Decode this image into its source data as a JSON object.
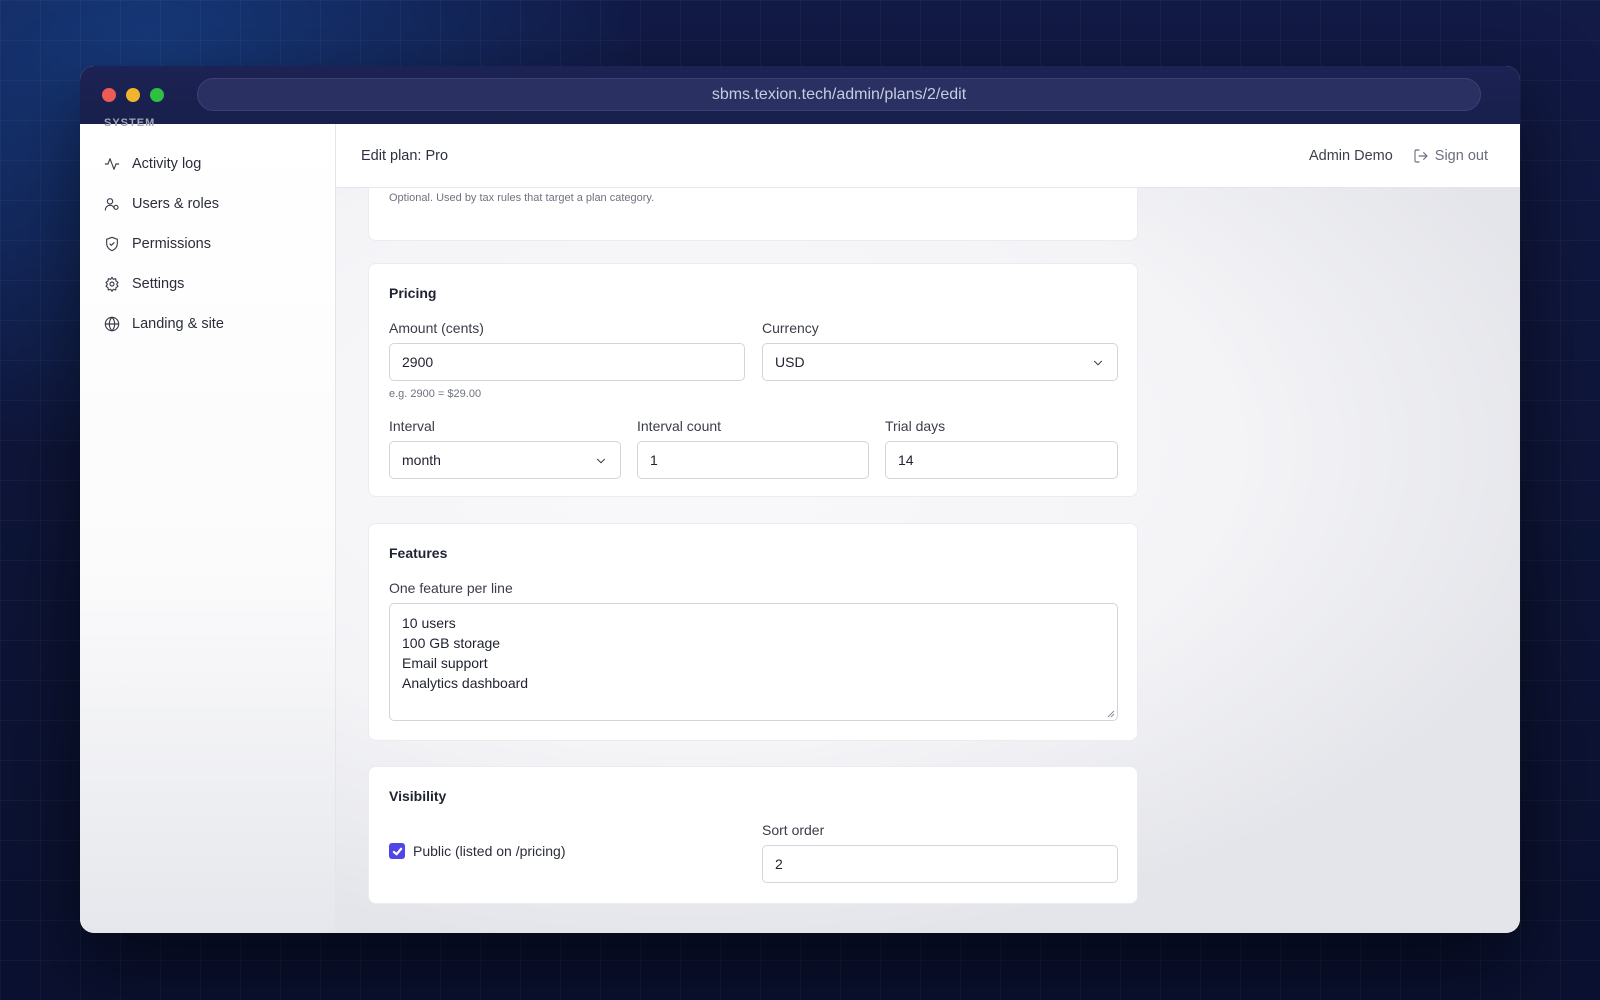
{
  "browser": {
    "url": "sbms.texion.tech/admin/plans/2/edit"
  },
  "sidebar": {
    "section_label": "System",
    "items": [
      {
        "label": "Activity log",
        "icon": "activity-icon"
      },
      {
        "label": "Users & roles",
        "icon": "users-icon"
      },
      {
        "label": "Permissions",
        "icon": "shield-icon"
      },
      {
        "label": "Settings",
        "icon": "gear-icon"
      },
      {
        "label": "Landing & site",
        "icon": "globe-icon"
      }
    ]
  },
  "header": {
    "title": "Edit plan: Pro",
    "user": "Admin Demo",
    "sign_out": "Sign out"
  },
  "category_card": {
    "hint": "Optional. Used by tax rules that target a plan category."
  },
  "pricing": {
    "title": "Pricing",
    "amount_label": "Amount (cents)",
    "amount_value": "2900",
    "amount_hint": "e.g. 2900 = $29.00",
    "currency_label": "Currency",
    "currency_value": "USD",
    "interval_label": "Interval",
    "interval_value": "month",
    "interval_count_label": "Interval count",
    "interval_count_value": "1",
    "trial_days_label": "Trial days",
    "trial_days_value": "14"
  },
  "features": {
    "title": "Features",
    "label": "One feature per line",
    "lines": [
      "10 users",
      "100 GB storage",
      "Email support",
      "Analytics dashboard"
    ]
  },
  "visibility": {
    "title": "Visibility",
    "public_label": "Public (listed on /pricing)",
    "public_checked": true,
    "sort_label": "Sort order",
    "sort_value": "2"
  },
  "colors": {
    "accent": "#4f46e5",
    "titlebar": "#1c2354"
  }
}
